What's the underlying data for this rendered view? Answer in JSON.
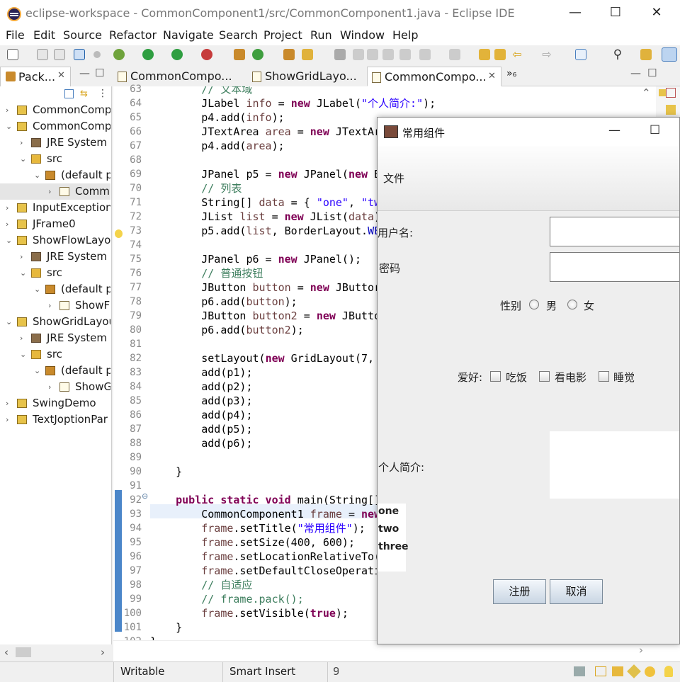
{
  "window": {
    "title": "eclipse-workspace - CommonComponent1/src/CommonComponent1.java - Eclipse IDE",
    "minimize": "—",
    "maximize": "☐",
    "close": "✕"
  },
  "menu": [
    "File",
    "Edit",
    "Source",
    "Refactor",
    "Navigate",
    "Search",
    "Project",
    "Run",
    "Window",
    "Help"
  ],
  "package_explorer": {
    "tab_label": "Pack...",
    "tree": [
      {
        "label": "CommonComp",
        "indent": 0,
        "chev": "›",
        "icon": "project-icon"
      },
      {
        "label": "CommonComp",
        "indent": 0,
        "chev": "⌄",
        "icon": "project-icon"
      },
      {
        "label": "JRE System L",
        "indent": 1,
        "chev": "›",
        "icon": "library-icon"
      },
      {
        "label": "src",
        "indent": 1,
        "chev": "⌄",
        "icon": "source-folder-icon"
      },
      {
        "label": "(default p",
        "indent": 2,
        "chev": "⌄",
        "icon": "package-icon"
      },
      {
        "label": "Comm",
        "indent": 3,
        "chev": "›",
        "icon": "java-file-icon",
        "selected": true
      },
      {
        "label": "InputException",
        "indent": 0,
        "chev": "›",
        "icon": "project-icon"
      },
      {
        "label": "JFrame0",
        "indent": 0,
        "chev": "›",
        "icon": "project-icon"
      },
      {
        "label": "ShowFlowLayo",
        "indent": 0,
        "chev": "⌄",
        "icon": "project-icon"
      },
      {
        "label": "JRE System L",
        "indent": 1,
        "chev": "›",
        "icon": "library-icon"
      },
      {
        "label": "src",
        "indent": 1,
        "chev": "⌄",
        "icon": "source-folder-icon"
      },
      {
        "label": "(default p",
        "indent": 2,
        "chev": "⌄",
        "icon": "package-icon"
      },
      {
        "label": "ShowF",
        "indent": 3,
        "chev": "›",
        "icon": "java-file-icon"
      },
      {
        "label": "ShowGridLayou",
        "indent": 0,
        "chev": "⌄",
        "icon": "project-icon"
      },
      {
        "label": "JRE System L",
        "indent": 1,
        "chev": "›",
        "icon": "library-icon"
      },
      {
        "label": "src",
        "indent": 1,
        "chev": "⌄",
        "icon": "source-folder-icon"
      },
      {
        "label": "(default p",
        "indent": 2,
        "chev": "⌄",
        "icon": "package-icon"
      },
      {
        "label": "ShowG",
        "indent": 3,
        "chev": "›",
        "icon": "java-file-icon"
      },
      {
        "label": "SwingDemo",
        "indent": 0,
        "chev": "›",
        "icon": "project-icon"
      },
      {
        "label": "TextJoptionPar",
        "indent": 0,
        "chev": "›",
        "icon": "project-icon"
      }
    ]
  },
  "editor_tabs": [
    {
      "label": "CommonCompo...",
      "active": false
    },
    {
      "label": "ShowGridLayo...",
      "active": false
    },
    {
      "label": "CommonCompo...",
      "active": true
    }
  ],
  "editor_tab_overflow": "»₆",
  "code": {
    "first_line": 63,
    "lines": [
      [
        [
          "cm",
          "        // 文本域"
        ]
      ],
      [
        [
          "",
          "        JLabel "
        ],
        [
          "vr",
          "info"
        ],
        [
          "",
          " = "
        ],
        [
          "kw",
          "new"
        ],
        [
          "",
          " JLabel("
        ],
        [
          "st",
          "\"个人简介:\""
        ],
        [
          "",
          ");"
        ]
      ],
      [
        [
          "",
          "        p4.add("
        ],
        [
          "vr",
          "info"
        ],
        [
          "",
          ");"
        ]
      ],
      [
        [
          "",
          "        JTextArea "
        ],
        [
          "vr",
          "area"
        ],
        [
          "",
          " = "
        ],
        [
          "kw",
          "new"
        ],
        [
          "",
          " JTextAr"
        ]
      ],
      [
        [
          "",
          "        p4.add("
        ],
        [
          "vr",
          "area"
        ],
        [
          "",
          ");"
        ]
      ],
      [
        [
          "",
          ""
        ]
      ],
      [
        [
          "",
          "        JPanel p5 = "
        ],
        [
          "kw",
          "new"
        ],
        [
          "",
          " JPanel("
        ],
        [
          "kw",
          "new"
        ],
        [
          "",
          " B"
        ]
      ],
      [
        [
          "cm",
          "        // 列表"
        ]
      ],
      [
        [
          "",
          "        String[] "
        ],
        [
          "vr",
          "data"
        ],
        [
          "",
          " = { "
        ],
        [
          "st",
          "\"one\""
        ],
        [
          "",
          ", "
        ],
        [
          "st",
          "\"tw"
        ]
      ],
      [
        [
          "",
          "        JList "
        ],
        [
          "vr",
          "list"
        ],
        [
          "",
          " = "
        ],
        [
          "kw",
          "new"
        ],
        [
          "",
          " JList("
        ],
        [
          "vr",
          "data"
        ],
        [
          "",
          ")"
        ]
      ],
      [
        [
          "",
          "        p5.add("
        ],
        [
          "vr",
          "list"
        ],
        [
          "",
          ", BorderLayout."
        ],
        [
          "fd",
          "WE"
        ]
      ],
      [
        [
          "",
          ""
        ]
      ],
      [
        [
          "",
          "        JPanel p6 = "
        ],
        [
          "kw",
          "new"
        ],
        [
          "",
          " JPanel();"
        ]
      ],
      [
        [
          "cm",
          "        // 普通按钮"
        ]
      ],
      [
        [
          "",
          "        JButton "
        ],
        [
          "vr",
          "button"
        ],
        [
          "",
          " = "
        ],
        [
          "kw",
          "new"
        ],
        [
          "",
          " JButtor"
        ]
      ],
      [
        [
          "",
          "        p6.add("
        ],
        [
          "vr",
          "button"
        ],
        [
          "",
          ");"
        ]
      ],
      [
        [
          "",
          "        JButton "
        ],
        [
          "vr",
          "button2"
        ],
        [
          "",
          " = "
        ],
        [
          "kw",
          "new"
        ],
        [
          "",
          " JButto"
        ]
      ],
      [
        [
          "",
          "        p6.add("
        ],
        [
          "vr",
          "button2"
        ],
        [
          "",
          ");"
        ]
      ],
      [
        [
          "",
          ""
        ]
      ],
      [
        [
          "",
          "        setLayout("
        ],
        [
          "kw",
          "new"
        ],
        [
          "",
          " GridLayout(7,"
        ]
      ],
      [
        [
          "",
          "        add(p1);"
        ]
      ],
      [
        [
          "",
          "        add(p2);"
        ]
      ],
      [
        [
          "",
          "        add(p3);"
        ]
      ],
      [
        [
          "",
          "        add(p4);"
        ]
      ],
      [
        [
          "",
          "        add(p5);"
        ]
      ],
      [
        [
          "",
          "        add(p6);"
        ]
      ],
      [
        [
          "",
          ""
        ]
      ],
      [
        [
          "",
          "    }"
        ]
      ],
      [
        [
          "",
          ""
        ]
      ],
      [
        [
          "kw",
          "    public static void"
        ],
        [
          "",
          " main(String[]"
        ]
      ],
      [
        [
          "",
          "        CommonComponent1 "
        ],
        [
          "vr",
          "frame"
        ],
        [
          "",
          " = "
        ],
        [
          "kw",
          "new"
        ]
      ],
      [
        [
          "",
          "        "
        ],
        [
          "vr",
          "frame"
        ],
        [
          "",
          ".setTitle("
        ],
        [
          "st",
          "\"常用组件\""
        ],
        [
          "",
          ");"
        ]
      ],
      [
        [
          "",
          "        "
        ],
        [
          "vr",
          "frame"
        ],
        [
          "",
          ".setSize(400, 600);"
        ]
      ],
      [
        [
          "",
          "        "
        ],
        [
          "vr",
          "frame"
        ],
        [
          "",
          ".setLocationRelativeTo("
        ]
      ],
      [
        [
          "",
          "        "
        ],
        [
          "vr",
          "frame"
        ],
        [
          "",
          ".setDefaultCloseOperati"
        ]
      ],
      [
        [
          "cm",
          "        // 自适应"
        ]
      ],
      [
        [
          "cm",
          "        // frame.pack();"
        ]
      ],
      [
        [
          "",
          "        "
        ],
        [
          "vr",
          "frame"
        ],
        [
          "",
          ".setVisible("
        ],
        [
          "kw",
          "true"
        ],
        [
          "",
          ");"
        ]
      ],
      [
        [
          "",
          "    }"
        ]
      ],
      [
        [
          "",
          "}"
        ]
      ]
    ]
  },
  "status": {
    "mode": "Writable",
    "insert": "Smart Insert",
    "pos": "9"
  },
  "swing_window": {
    "title": "常用组件",
    "minimize": "—",
    "maximize": "☐",
    "menu_label": "文件",
    "username_label": "用户名:",
    "password_label": "密码",
    "gender_label": "性别",
    "gender_options": [
      "男",
      "女"
    ],
    "hobby_label": "爱好:",
    "hobby_options": [
      "吃饭",
      "看电影",
      "睡觉"
    ],
    "bio_label": "个人简介:",
    "list_items": [
      "one",
      "two",
      "three"
    ],
    "register_button": "注册",
    "cancel_button": "取消"
  }
}
